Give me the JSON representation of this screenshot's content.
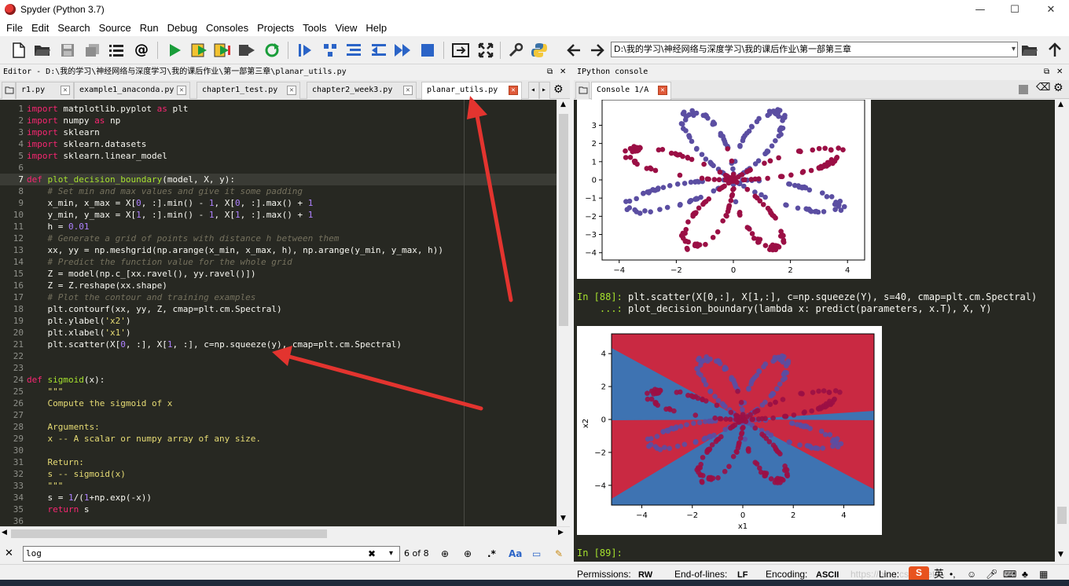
{
  "window": {
    "title": "Spyder (Python 3.7)",
    "controls": {
      "minimize": "—",
      "maximize": "☐",
      "close": "✕"
    }
  },
  "menu": [
    "File",
    "Edit",
    "Search",
    "Source",
    "Run",
    "Debug",
    "Consoles",
    "Projects",
    "Tools",
    "View",
    "Help"
  ],
  "toolbar": {
    "path": "D:\\我的学习\\神经网络与深度学习\\我的课后作业\\第一部第三章",
    "icons": [
      "new-file-icon",
      "open-file-icon",
      "save-icon",
      "save-all-icon",
      "list-icon",
      "at-icon",
      "run-icon",
      "run-cell-icon",
      "run-cell-advance-icon",
      "run-selection-icon",
      "rerun-icon",
      "debug-icon",
      "step-icon",
      "step-into-icon",
      "step-return-icon",
      "continue-icon",
      "stop-icon",
      "maximize-pane-icon",
      "fullscreen-icon",
      "preferences-icon",
      "python-path-icon",
      "back-arrow-icon",
      "folder-icon",
      "up-arrow-icon"
    ]
  },
  "editor": {
    "header": "Editor - D:\\我的学习\\神经网络与深度学习\\我的课后作业\\第一部第三章\\planar_utils.py",
    "tabs": [
      {
        "label": "r1.py",
        "active": false
      },
      {
        "label": "example1_anaconda.py",
        "active": false
      },
      {
        "label": "chapter1_test.py",
        "active": false
      },
      {
        "label": "chapter2_week3.py",
        "active": false
      },
      {
        "label": "planar_utils.py",
        "active": true
      }
    ],
    "current_line": 7,
    "lines": [
      "import matplotlib.pyplot as plt",
      "import numpy as np",
      "import sklearn",
      "import sklearn.datasets",
      "import sklearn.linear_model",
      "",
      "def plot_decision_boundary(model, X, y):",
      "    # Set min and max values and give it some padding",
      "    x_min, x_max = X[0, :].min() - 1, X[0, :].max() + 1",
      "    y_min, y_max = X[1, :].min() - 1, X[1, :].max() + 1",
      "    h = 0.01",
      "    # Generate a grid of points with distance h between them",
      "    xx, yy = np.meshgrid(np.arange(x_min, x_max, h), np.arange(y_min, y_max, h))",
      "    # Predict the function value for the whole grid",
      "    Z = model(np.c_[xx.ravel(), yy.ravel()])",
      "    Z = Z.reshape(xx.shape)",
      "    # Plot the contour and training examples",
      "    plt.contourf(xx, yy, Z, cmap=plt.cm.Spectral)",
      "    plt.ylabel('x2')",
      "    plt.xlabel('x1')",
      "    plt.scatter(X[0, :], X[1, :], c=np.squeeze(y), cmap=plt.cm.Spectral)",
      "",
      "",
      "def sigmoid(x):",
      "    \"\"\"",
      "    Compute the sigmoid of x",
      "",
      "    Arguments:",
      "    x -- A scalar or numpy array of any size.",
      "",
      "    Return:",
      "    s -- sigmoid(x)",
      "    \"\"\"",
      "    s = 1/(1+np.exp(-x))",
      "    return s",
      ""
    ]
  },
  "find": {
    "value": "log",
    "clear": "✖",
    "count": "6 of 8",
    "regex": ".*",
    "case": "Aa"
  },
  "console": {
    "header": "IPython console",
    "tab": "Console 1/A",
    "in88_prompt": "In [88]:",
    "in88_code": "plt.scatter(X[0,:], X[1,:], c=np.squeeze(Y), s=40, cmap=plt.cm.Spectral)",
    "cont_prompt": "...:",
    "cont_code": "plot_decision_boundary(lambda x: predict(parameters, x.T), X, Y)",
    "in89_prompt": "In [89]:",
    "plot1": {
      "xticks": [
        "−4",
        "−2",
        "0",
        "2",
        "4"
      ],
      "yticks": [
        "3",
        "2",
        "1",
        "0",
        "−1",
        "−2",
        "−3",
        "−4"
      ]
    },
    "plot2": {
      "xticks": [
        "−4",
        "−2",
        "0",
        "2",
        "4"
      ],
      "yticks": [
        "4",
        "2",
        "0",
        "−2",
        "−4"
      ],
      "xlabel": "x1",
      "ylabel": "x2",
      "colors": {
        "red": "#c92942",
        "blue": "#3e73b2",
        "dot_red": "#9b0f45",
        "dot_blue": "#5b4ea2"
      }
    }
  },
  "status": {
    "permissions_label": "Permissions:",
    "permissions": "RW",
    "eol_label": "End-of-lines:",
    "eol": "LF",
    "encoding_label": "Encoding:",
    "encoding": "ASCII",
    "line_label": "Line:",
    "watermark": "https://blog.csdn.net/...",
    "ime_lang": "英"
  }
}
